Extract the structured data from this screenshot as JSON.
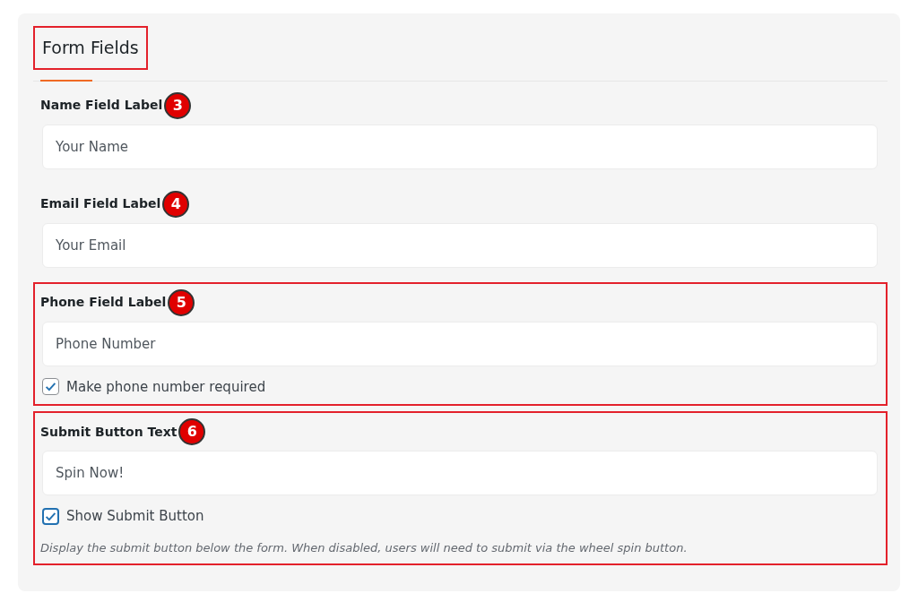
{
  "title": {
    "text": "Form Fields",
    "highlighted": true
  },
  "fields": [
    {
      "label": "Name Field Label",
      "badge": "3",
      "value": "Your Name",
      "highlighted": false
    },
    {
      "label": "Email Field Label",
      "badge": "4",
      "value": "Your Email",
      "highlighted": false
    },
    {
      "label": "Phone Field Label",
      "badge": "5",
      "value": "Phone Number",
      "highlighted": true,
      "checkbox": {
        "label": "Make phone number required",
        "checked": true
      }
    },
    {
      "label": "Submit Button Text",
      "badge": "6",
      "value": "Spin Now!",
      "highlighted": true,
      "checkbox": {
        "label": "Show Submit Button",
        "checked": true
      },
      "help": "Display the submit button below the form. When disabled, users will need to submit via the wheel spin button."
    }
  ]
}
